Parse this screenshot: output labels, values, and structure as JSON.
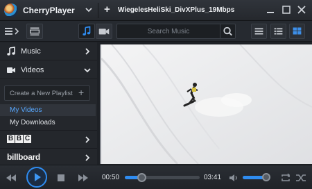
{
  "app": {
    "name": "CherryPlayer",
    "file_title": "WiegelesHeliSki_DivXPlus_19Mbps",
    "add_tab_glyph": "+"
  },
  "icons": {
    "logo": "cherryplayer-logo",
    "app_menu": "chevron-down-icon",
    "minimize": "minimize-icon",
    "maximize": "maximize-icon",
    "close": "close-icon",
    "menu": "hamburger-menu-icon",
    "queue": "playlist-queue-icon",
    "music_mode": "music-note-icon",
    "video_mode": "video-camera-icon",
    "search": "search-icon",
    "view_list": "list-view-icon",
    "view_detail": "detail-view-icon",
    "view_grid": "grid-view-icon"
  },
  "search": {
    "placeholder": "Search Music"
  },
  "sidebar": {
    "music_label": "Music",
    "videos_label": "Videos",
    "create_playlist_label": "Create a New Playlist",
    "create_playlist_plus": "+",
    "playlists": [
      {
        "label": "My Videos",
        "active": true
      },
      {
        "label": "My Downloads",
        "active": false
      }
    ],
    "bbc_letters": [
      "B",
      "B",
      "C"
    ],
    "billboard_label": "billboard"
  },
  "player": {
    "current_time": "00:50",
    "duration": "03:41",
    "progress_fraction": 0.226,
    "volume_fraction": 0.9
  },
  "colors": {
    "accent": "#2f8cf0",
    "active_text": "#57a8ff",
    "background": "#1e2126"
  }
}
